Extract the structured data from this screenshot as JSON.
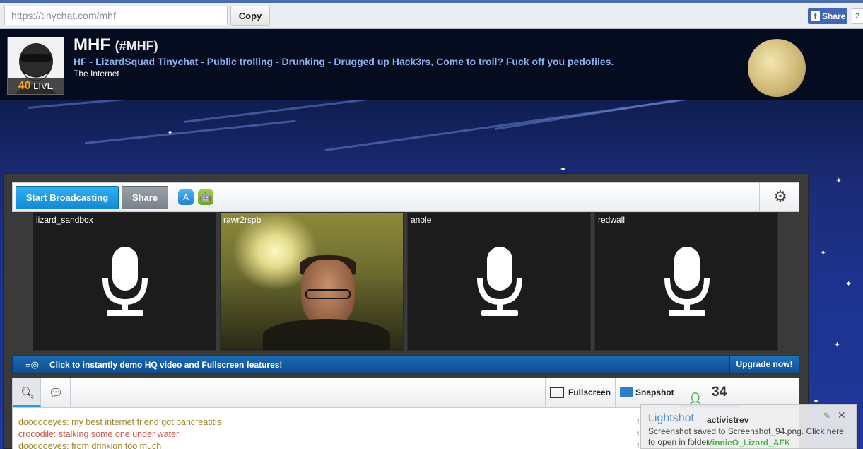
{
  "browser": {
    "url": "https://tinychat.com/mhf",
    "copy_label": "Copy",
    "fb_share_label": "Share",
    "fb_count": "2"
  },
  "room": {
    "live_count": "40",
    "live_label": "LIVE",
    "name": "MHF",
    "handle": "(#MHF)",
    "description": "HF - LizardSquad Tinychat - Public trolling - Drunking - Drugged up Hack3rs, Come to troll? Fuck off you pedofiles.",
    "location": "The Internet"
  },
  "toolbar": {
    "broadcast_label": "Start Broadcasting",
    "share_label": "Share"
  },
  "cams": [
    {
      "name": "lizard_sandbox",
      "type": "mic"
    },
    {
      "name": "rawr2rspb",
      "type": "video"
    },
    {
      "name": "anole",
      "type": "mic"
    },
    {
      "name": "redwall",
      "type": "mic"
    }
  ],
  "promo": {
    "text": "Click to instantly demo HQ video and Fullscreen features!",
    "upgrade_label": "Upgrade now!"
  },
  "chat_tabs": {
    "fullscreen_label": "Fullscreen",
    "snapshot_label": "Snapshot",
    "user_count": "34"
  },
  "chat": {
    "messages": [
      {
        "user": "doodooeyes",
        "text": "my best internet friend got pancreatitis",
        "color": "#a0822a",
        "time": "12:28"
      },
      {
        "user": "crocodile",
        "text": "stalking some one under water",
        "color": "#c2574a",
        "time": "12:28"
      },
      {
        "user": "doodooeyes",
        "text": "from drinkign too much",
        "color": "#a0822a",
        "time": "12:28"
      }
    ]
  },
  "toast": {
    "title": "Lightshot",
    "user_top": "activistrev",
    "message": "Screenshot saved to Screenshot_94.png. Click here to open in folder.",
    "user_bottom": "VinnieO_Lizard_AFK"
  },
  "colors": {
    "broadcast_blue": "#1f9be3",
    "promo_blue": "#145d9f",
    "live_orange": "#f5a623",
    "desc_blue": "#8fb0ee"
  }
}
